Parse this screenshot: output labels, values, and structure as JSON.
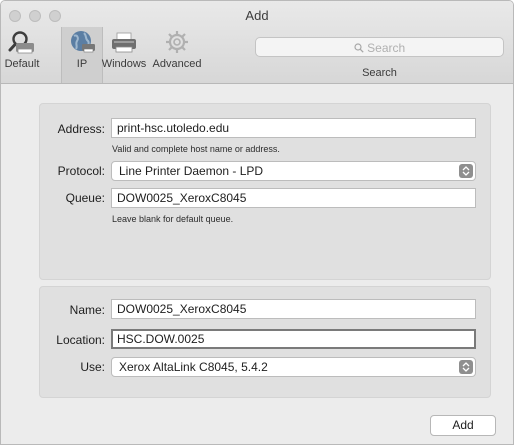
{
  "window": {
    "title": "Add"
  },
  "toolbar": {
    "items": [
      {
        "label": "Default",
        "icon": "default-printer-icon",
        "selected": false
      },
      {
        "label": "IP",
        "icon": "globe-icon",
        "selected": true
      },
      {
        "label": "Windows",
        "icon": "windows-printer-icon",
        "selected": false
      },
      {
        "label": "Advanced",
        "icon": "gear-icon",
        "selected": false
      }
    ],
    "search": {
      "placeholder": "Search",
      "caption": "Search"
    }
  },
  "ip_panel": {
    "address": {
      "label": "Address:",
      "value": "print-hsc.utoledo.edu",
      "hint": "Valid and complete host name or address."
    },
    "protocol": {
      "label": "Protocol:",
      "value": "Line Printer Daemon - LPD"
    },
    "queue": {
      "label": "Queue:",
      "value": "DOW0025_XeroxC8045",
      "hint": "Leave blank for default queue."
    }
  },
  "printer_panel": {
    "name": {
      "label": "Name:",
      "value": "DOW0025_XeroxC8045"
    },
    "location": {
      "label": "Location:",
      "value": "HSC.DOW.0025"
    },
    "use": {
      "label": "Use:",
      "value": "Xerox AltaLink C8045, 5.4.2"
    }
  },
  "footer": {
    "add_label": "Add"
  },
  "colors": {
    "window_bg": "#ececec",
    "panel_bg": "#e0e0e0",
    "stepper": "#8f8f8f"
  }
}
